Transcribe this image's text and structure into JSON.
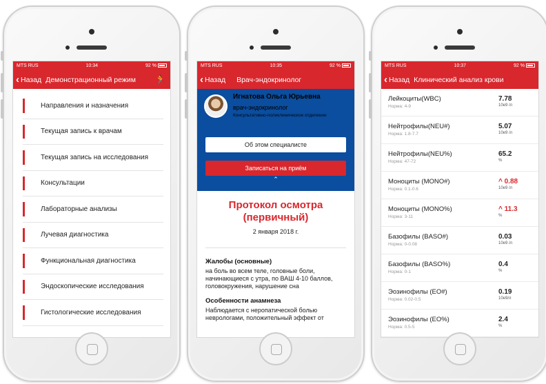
{
  "phones": [
    {
      "status": {
        "carrier": "MTS RUS",
        "time": "10:34",
        "battery": "92 %"
      },
      "nav": {
        "back": "Назад",
        "title": "Демонстрационный режим"
      },
      "menu": [
        "Направления и назначения",
        "Текущая запись к врачам",
        "Текущая запись на исследования",
        "Консультации",
        "Лабораторные анализы",
        "Лучевая диагностика",
        "Функциональная диагностика",
        "Эндоскопические исследования",
        "Гистологические исследования"
      ]
    },
    {
      "status": {
        "carrier": "MTS RUS",
        "time": "10:35",
        "battery": "92 %"
      },
      "nav": {
        "back": "Назад",
        "title": "Врач-эндокринолог"
      },
      "doctor": {
        "name": "Игнатова Ольга Юрьевна",
        "role": "врач-эндокринолог",
        "dept": "Консультативно-поликлиническое отделение",
        "about_button": "Об этом специалисте",
        "book_button": "Записаться на приём"
      },
      "protocol": {
        "title_line1": "Протокол осмотра",
        "title_line2": "(первичный)",
        "date": "2 января 2018 г.",
        "complaints_heading": "Жалобы (основные)",
        "complaints_text": "на боль во всем теле, головные боли, начинающиеся с утра, по ВАШ 4-10 баллов, головокружения, нарушение сна",
        "anamnesis_heading": "Особенности анамнеза",
        "anamnesis_text": "Наблюдается с неропатической болью неврологами, положительный эффект от"
      }
    },
    {
      "status": {
        "carrier": "MTS RUS",
        "time": "10:37",
        "battery": "92 %"
      },
      "nav": {
        "back": "Назад",
        "title": "Клинический анализ крови"
      },
      "results": [
        {
          "name": "Лейкоциты(WBC)",
          "norm": "Норма: 4-9",
          "value": "7.78",
          "unit": "10е9 /л",
          "high": false
        },
        {
          "name": "Нейтрофилы(NEU#)",
          "norm": "Норма: 1.8-7.7",
          "value": "5.07",
          "unit": "10е9 /л",
          "high": false
        },
        {
          "name": "Нейтрофилы(NEU%)",
          "norm": "Норма: 47-72",
          "value": "65.2",
          "unit": "%",
          "high": false
        },
        {
          "name": "Моноциты (MONO#)",
          "norm": "Норма: 0.1-0.6",
          "value": "0.88",
          "unit": "10е9 /л",
          "high": true
        },
        {
          "name": "Моноциты (MONO%)",
          "norm": "Норма: 3-11",
          "value": "11.3",
          "unit": "%",
          "high": true
        },
        {
          "name": "Базофилы (BASO#)",
          "norm": "Норма: 0-0.08",
          "value": "0.03",
          "unit": "10е9 /л",
          "high": false
        },
        {
          "name": "Базофилы (BASO%)",
          "norm": "Норма: 0-1",
          "value": "0.4",
          "unit": "%",
          "high": false
        },
        {
          "name": "Эозинофилы (EO#)",
          "norm": "Норма: 0.02-0.5",
          "value": "0.19",
          "unit": "10е9/л",
          "high": false
        },
        {
          "name": "Эозинофилы (EO%)",
          "norm": "Норма: 0.5-5",
          "value": "2.4",
          "unit": "%",
          "high": false
        }
      ]
    }
  ],
  "colors": {
    "brand_red": "#d8272d",
    "doctor_blue": "#0b4d9e"
  },
  "icons": {
    "back": "chevron-left-icon",
    "runner": "runner-icon",
    "collapse": "chevron-up-icon",
    "high": "arrow-up-icon"
  }
}
